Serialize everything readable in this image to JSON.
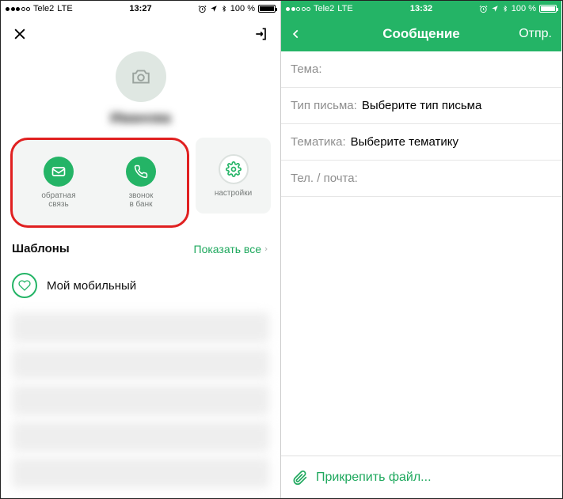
{
  "left": {
    "status": {
      "carrier": "Tele2",
      "net": "LTE",
      "time": "13:27",
      "batt": "100 %"
    },
    "name": "Иванова",
    "actions": {
      "feedback": "обратная\nсвязь",
      "call": "звонок\nв банк",
      "settings": "настройки"
    },
    "section": {
      "title": "Шаблоны",
      "link": "Показать все"
    },
    "template_item": "Мой мобильный"
  },
  "right": {
    "status": {
      "carrier": "Tele2",
      "net": "LTE",
      "time": "13:32",
      "batt": "100 %"
    },
    "nav": {
      "title": "Сообщение",
      "send": "Отпр."
    },
    "fields": {
      "subject_label": "Тема:",
      "type_label": "Тип письма:",
      "type_value": "Выберите тип письма",
      "topic_label": "Тематика:",
      "topic_value": "Выберите тематику",
      "contact_label": "Тел. / почта:"
    },
    "attach": "Прикрепить файл..."
  }
}
